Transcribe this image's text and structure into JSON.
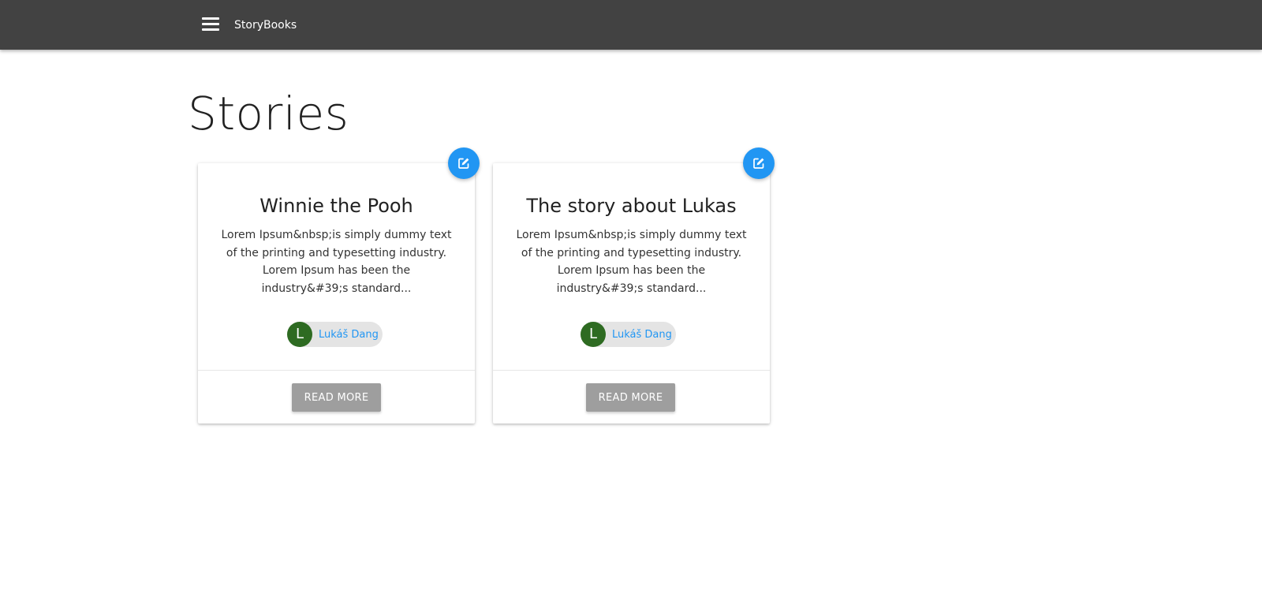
{
  "navbar": {
    "brand": "StoryBooks"
  },
  "page": {
    "title": "Stories"
  },
  "stories": [
    {
      "title": "Winnie the Pooh",
      "excerpt": "Lorem Ipsum&nbsp;is simply dummy text of the printing and typesetting industry. Lorem Ipsum has been the industry&#39;s standard...",
      "author": {
        "initial": "L",
        "name": "Lukáš Dang"
      },
      "action_label": "READ MORE"
    },
    {
      "title": "The story about Lukas",
      "excerpt": "Lorem Ipsum&nbsp;is simply dummy text of the printing and typesetting industry. Lorem Ipsum has been the industry&#39;s standard...",
      "author": {
        "initial": "L",
        "name": "Lukáš Dang"
      },
      "action_label": "READ MORE"
    }
  ],
  "icons": {
    "menu": "hamburger-menu-icon",
    "edit": "edit-pencil-square-icon"
  },
  "colors": {
    "navbar": "#424242",
    "accent": "#2196f3",
    "avatar": "#2e6b22",
    "button": "#9e9e9e",
    "chip": "#e4e4e4"
  }
}
